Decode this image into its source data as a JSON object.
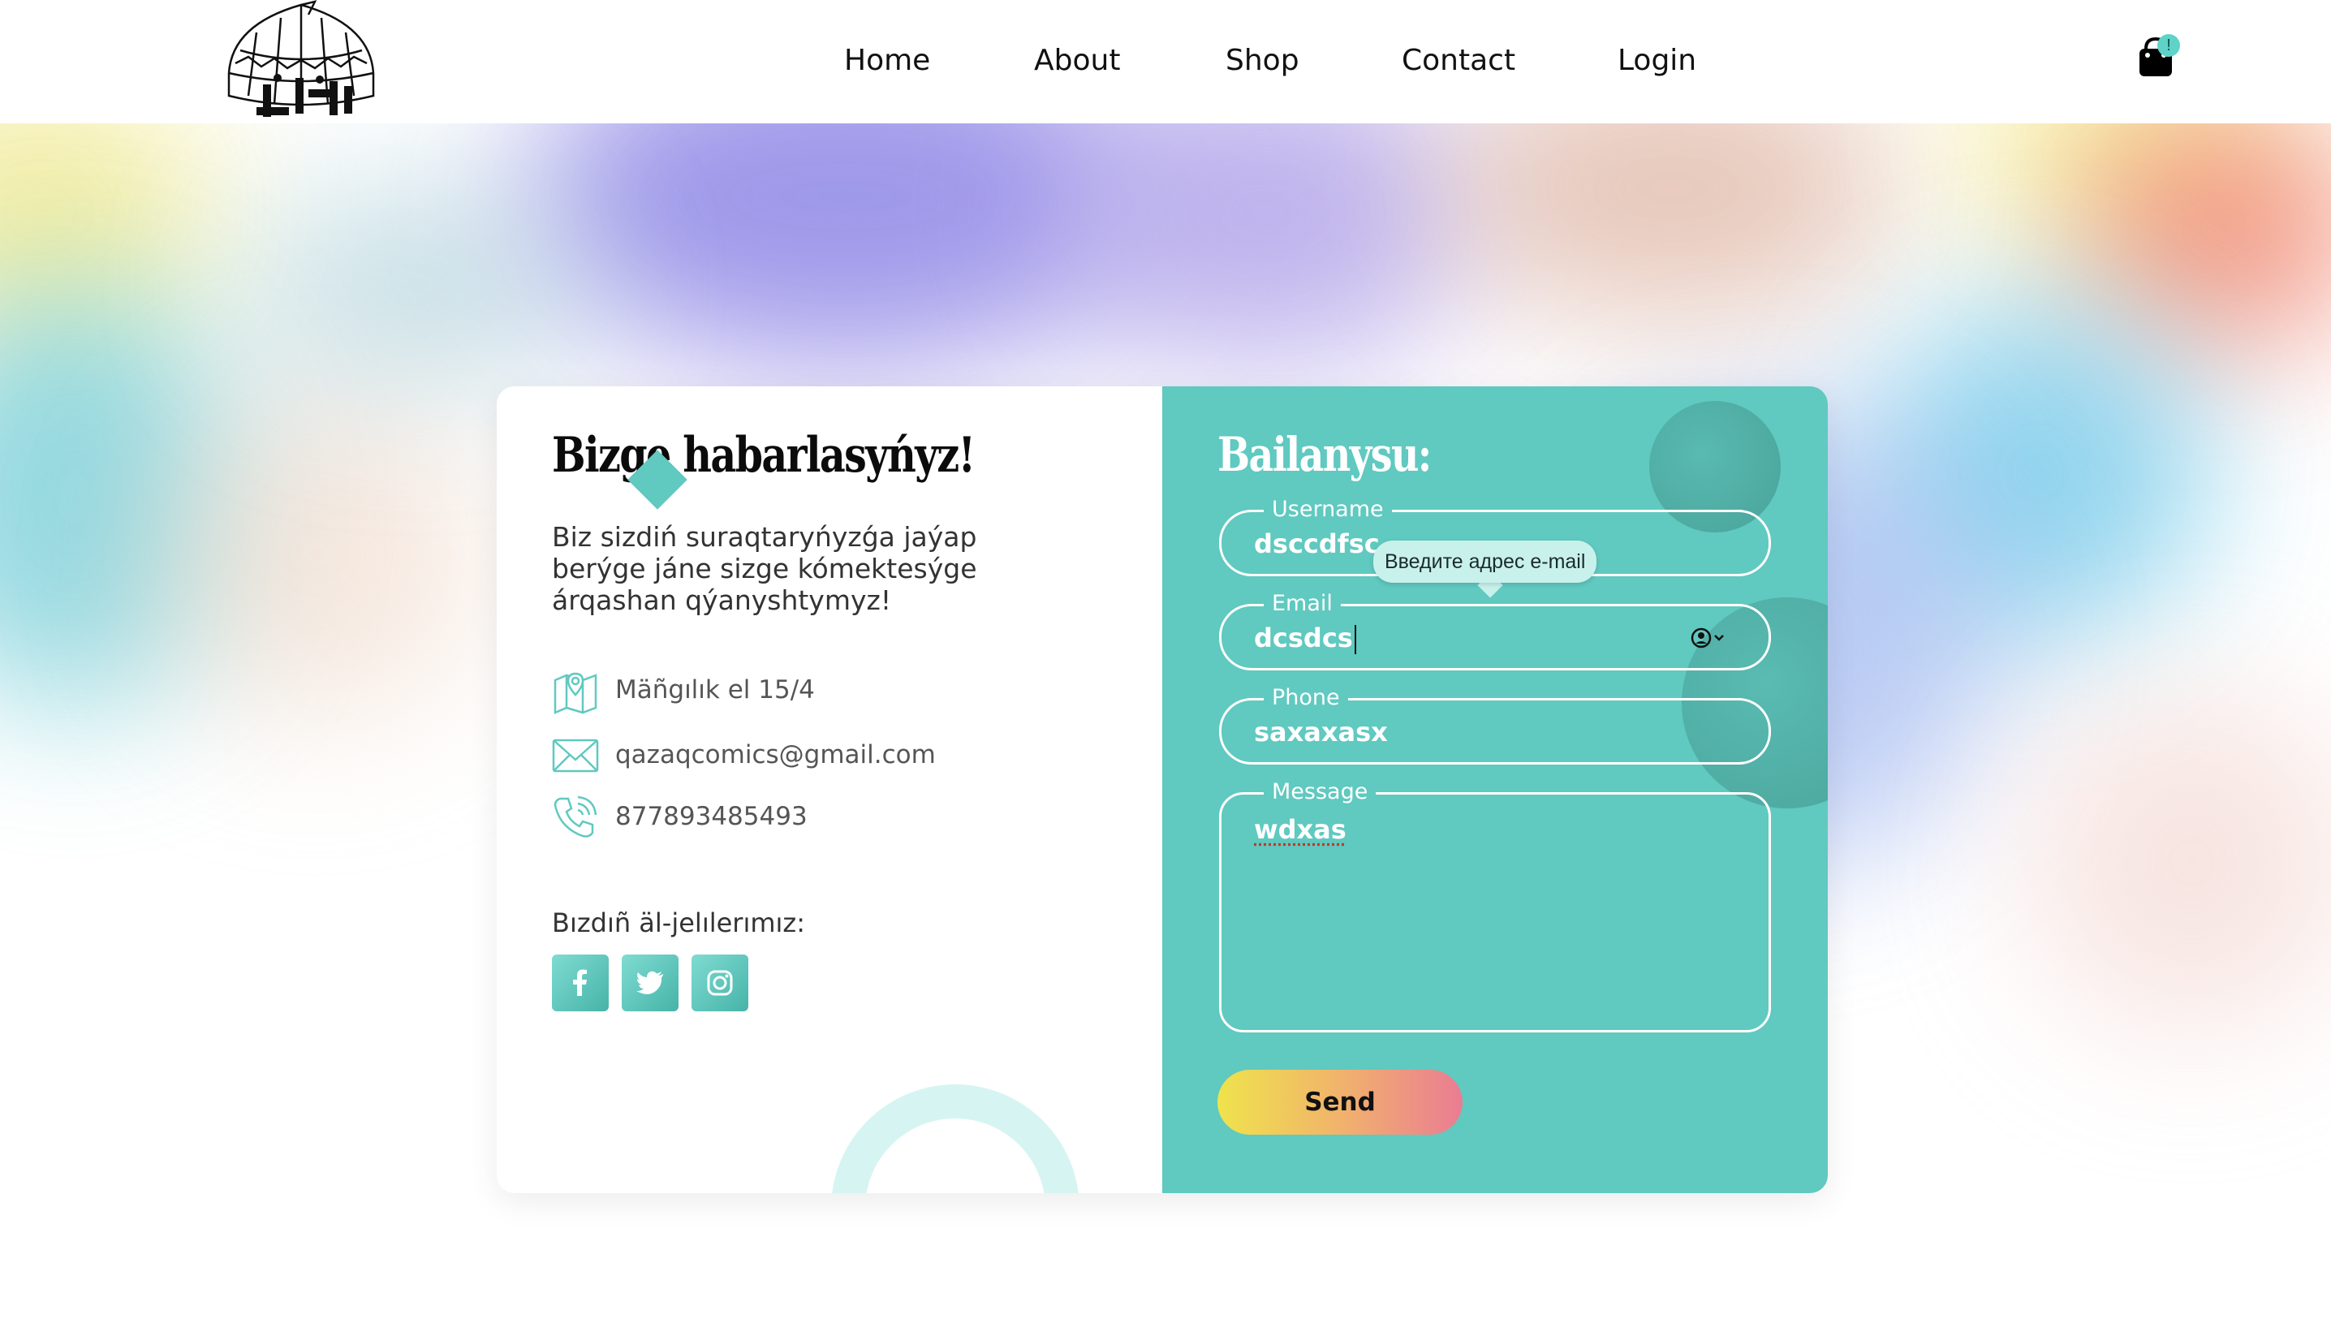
{
  "nav": {
    "items": [
      "Home",
      "About",
      "Shop",
      "Contact",
      "Login"
    ]
  },
  "cart": {
    "badge": "!",
    "icon": "shopping-bag-icon"
  },
  "logo": {
    "icon": "yurt-logo-icon"
  },
  "contact_info": {
    "title": "Bizge habarlasyńyz!",
    "intro": "Biz sizdiń suraqtaryńyzǵa jaýap berýge jáne sizge kómektesýge árqashan qýanyshtymyz!",
    "address": "Mäñgılık el 15/4",
    "email": "qazaqcomics@gmail.com",
    "phone": "877893485493",
    "social_title": "Bızdıñ äl-jelılerımız:",
    "social": [
      "facebook-icon",
      "twitter-icon",
      "instagram-icon"
    ]
  },
  "form": {
    "title": "Bailanysu:",
    "username_label": "Username",
    "username_value": "dsccdfsc",
    "email_label": "Email",
    "email_value": "dcsdcs",
    "phone_label": "Phone",
    "phone_value": "saxaxasx",
    "message_label": "Message",
    "message_value": "wdxas",
    "send_label": "Send",
    "validation_tooltip": "Введите адрес e-mail"
  },
  "colors": {
    "accent": "#60c9c0",
    "light_accent": "#d6f5f2",
    "button_gradient": [
      "#efe34b",
      "#ea7c93"
    ]
  }
}
